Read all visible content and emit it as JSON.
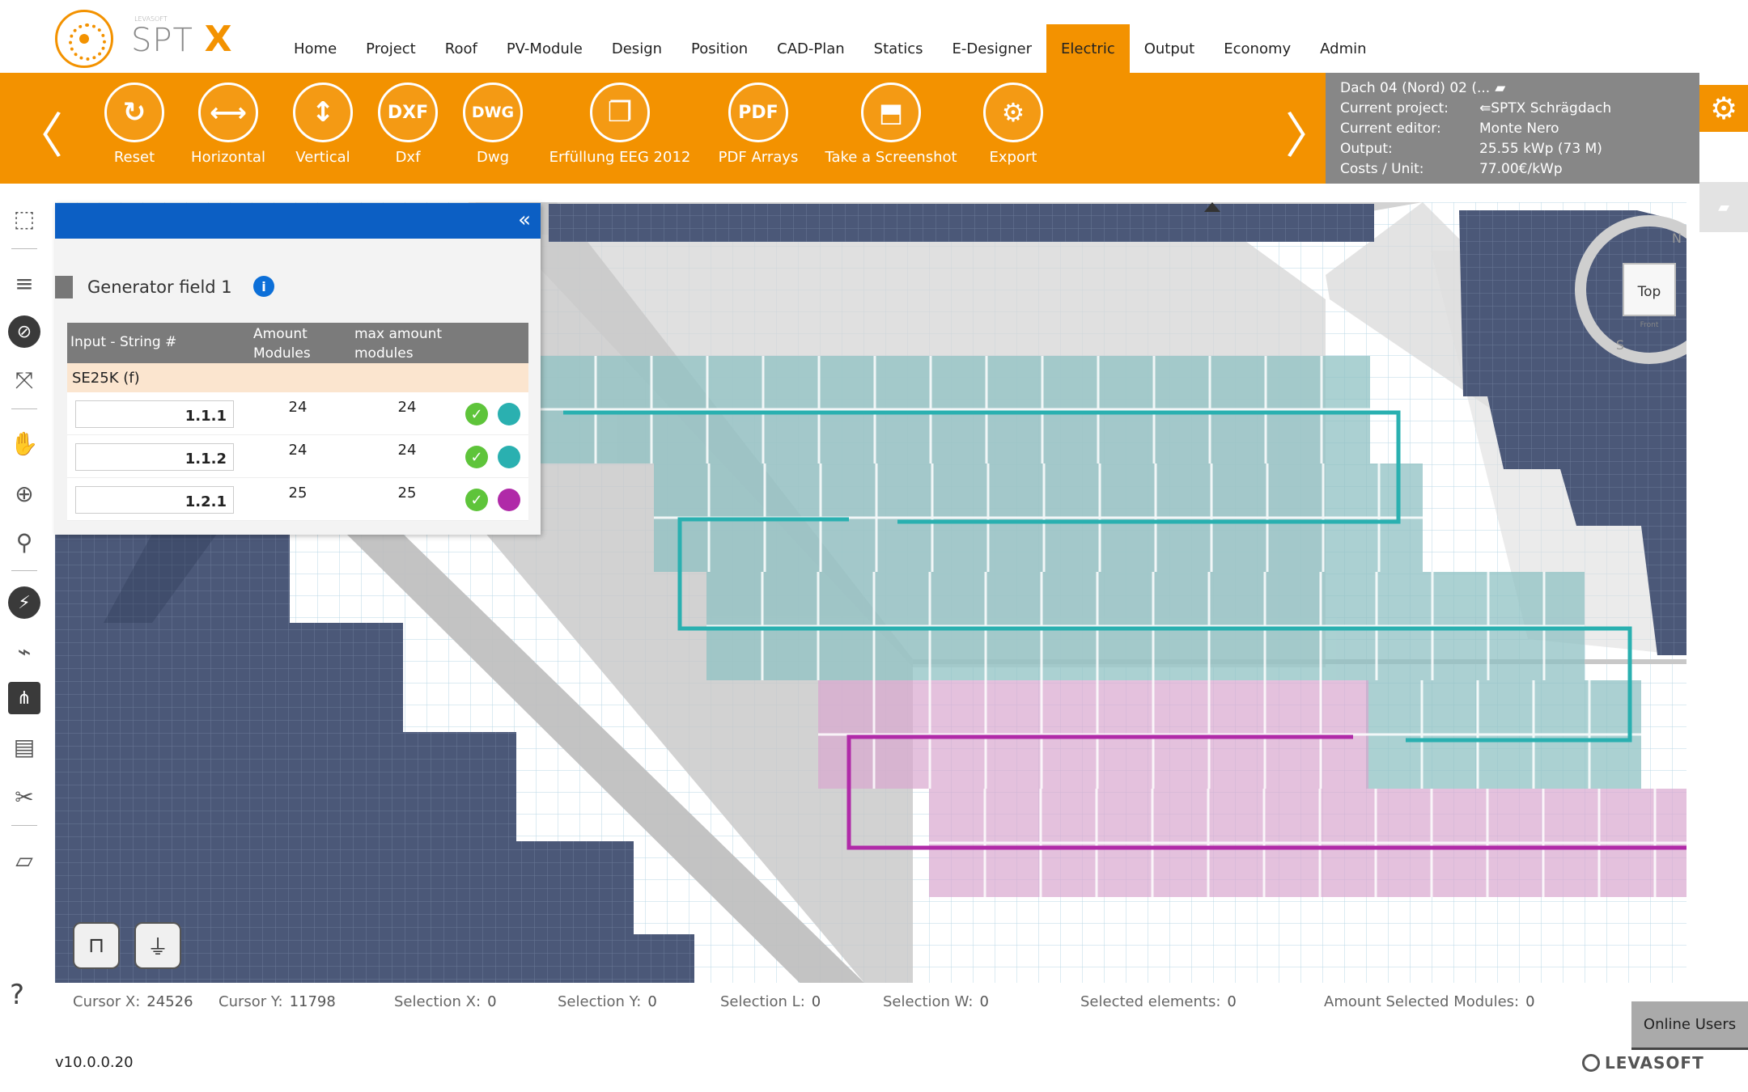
{
  "app": {
    "logo_text": "SPT",
    "logo_x": "X",
    "logo_small": "LEVASOFT"
  },
  "nav": {
    "items": [
      "Home",
      "Project",
      "Roof",
      "PV-Module",
      "Design",
      "Position",
      "CAD-Plan",
      "Statics",
      "E-Designer",
      "Electric",
      "Output",
      "Economy",
      "Admin"
    ],
    "active": "Electric"
  },
  "toolbar": {
    "prev_icon": "chevron-left-icon",
    "next_icon": "chevron-right-icon",
    "buttons": [
      {
        "label": "Reset",
        "icon": "reset-globe-icon",
        "glyph": "↻"
      },
      {
        "label": "Horizontal",
        "icon": "horizontal-arrows-icon",
        "glyph": "⟷"
      },
      {
        "label": "Vertical",
        "icon": "vertical-arrows-icon",
        "glyph": "↕"
      },
      {
        "label": "Dxf",
        "icon": "dxf-file-icon",
        "glyph": "DXF"
      },
      {
        "label": "Dwg",
        "icon": "dwg-file-icon",
        "glyph": "DWG"
      },
      {
        "label": "Erfüllung EEG 2012",
        "icon": "document-copy-icon",
        "glyph": "❐"
      },
      {
        "label": "PDF Arrays",
        "icon": "pdf-icon",
        "glyph": "PDF"
      },
      {
        "label": "Take a Screenshot",
        "icon": "screenshot-icon",
        "glyph": "⬒"
      },
      {
        "label": "Export",
        "icon": "export-icon",
        "glyph": "⚙"
      }
    ]
  },
  "info_panel": {
    "roof": "Dach 04 (Nord) 02 (...",
    "rows": [
      {
        "key": "Current project:",
        "value": "⇚SPTX Schrägdach"
      },
      {
        "key": "Current editor:",
        "value": "Monte Nero"
      },
      {
        "key": "Output:",
        "value": "25.55 kWp (73 M)"
      },
      {
        "key": "Costs / Unit:",
        "value": "77.00€/kWp"
      }
    ]
  },
  "generator_panel": {
    "title": "Generator field 1",
    "collapse_glyph": "«",
    "info_glyph": "i",
    "columns": {
      "input": "Input - String #",
      "amount_1": "Amount",
      "amount_2": "Modules",
      "max_1": "max amount",
      "max_2": "modules"
    },
    "group": "SE25K (f)",
    "rows": [
      {
        "string": "1.1.1",
        "amount": "24",
        "max": "24",
        "color": "#2ab0b0"
      },
      {
        "string": "1.1.2",
        "amount": "24",
        "max": "24",
        "color": "#2ab0b0"
      },
      {
        "string": "1.2.1",
        "amount": "25",
        "max": "25",
        "color": "#b02aa8"
      }
    ]
  },
  "compass": {
    "label": "Top",
    "sub": "Front",
    "n": "N",
    "s": "S"
  },
  "status": {
    "cursor_x_label": "Cursor X:",
    "cursor_x": "24526",
    "cursor_y_label": "Cursor Y:",
    "cursor_y": "11798",
    "sel_x_label": "Selection X:",
    "sel_x": "0",
    "sel_y_label": "Selection Y:",
    "sel_y": "0",
    "sel_l_label": "Selection L:",
    "sel_l": "0",
    "sel_w_label": "Selection W:",
    "sel_w": "0",
    "sel_el_label": "Selected elements:",
    "sel_el": "0",
    "sel_mod_label": "Amount Selected Modules:",
    "sel_mod": "0"
  },
  "footer": {
    "version": "v10.0.0.20",
    "online_users": "Online Users",
    "brand": "LEVASOFT",
    "help": "?"
  },
  "colors": {
    "accent": "#f39200",
    "panel_blue": "#0c5fc4",
    "string_teal": "#2ab0b0",
    "string_magenta": "#b02aa8"
  }
}
